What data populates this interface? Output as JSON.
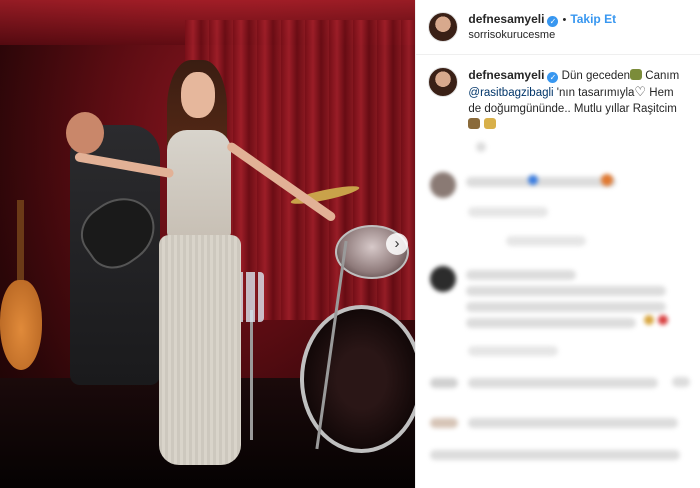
{
  "header": {
    "username": "defnesamyeli",
    "separator": "•",
    "follow_label": "Takip Et",
    "location": "sorrisokurucesme"
  },
  "caption": {
    "username": "defnesamyeli",
    "text_part1": "Dün geceden",
    "text_part2": " Canım ",
    "mention": "@rasitbagzibagli",
    "text_part3": " 'nın tasarımıyla",
    "text_part4": " Hem de doğumgününde.. Mutlu yıllar Raşitcim"
  },
  "colors": {
    "accent": "#3897f0",
    "mention": "#003569"
  },
  "icons": {
    "verified": "verified-badge-icon",
    "heart": "heart-outline-icon",
    "carousel_next": "chevron-right-icon"
  }
}
